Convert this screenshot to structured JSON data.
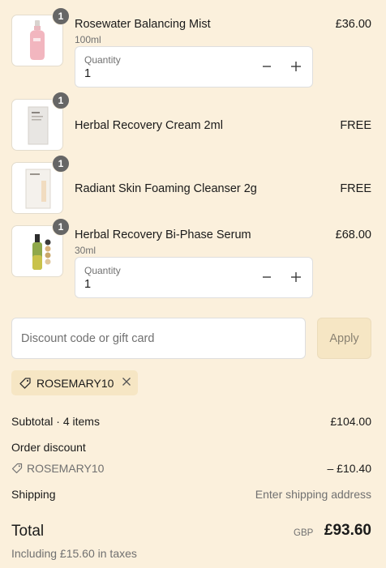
{
  "line_items": [
    {
      "name": "Rosewater Balancing Mist",
      "variant": "100ml",
      "price": "£36.00",
      "qty_badge": "1",
      "quantity_label": "Quantity",
      "quantity_value": "1",
      "image_icon": "pink-mist-bottle-icon"
    },
    {
      "name": "Herbal Recovery Cream 2ml",
      "price": "FREE",
      "qty_badge": "1",
      "image_icon": "cream-sachet-icon"
    },
    {
      "name": "Radiant Skin Foaming Cleanser 2g",
      "price": "FREE",
      "qty_badge": "1",
      "image_icon": "cleanser-sachet-icon"
    },
    {
      "name": "Herbal Recovery Bi-Phase Serum",
      "variant": "30ml",
      "price": "£68.00",
      "qty_badge": "1",
      "quantity_label": "Quantity",
      "quantity_value": "1",
      "image_icon": "serum-bottle-icon"
    }
  ],
  "discount": {
    "placeholder": "Discount code or gift card",
    "apply_label": "Apply",
    "applied_code": "ROSEMARY10"
  },
  "summary": {
    "subtotal_label": "Subtotal · 4 items",
    "subtotal_value": "£104.00",
    "order_discount_label": "Order discount",
    "discount_code": "ROSEMARY10",
    "discount_value": "– £10.40",
    "shipping_label": "Shipping",
    "shipping_value": "Enter shipping address",
    "total_label": "Total",
    "currency": "GBP",
    "total_value": "£93.60",
    "taxes_note": "Including £15.60 in taxes"
  },
  "colors": {
    "background": "#fbf0dc",
    "badge": "#666666",
    "chip": "#f6e6c4",
    "muted_text": "#707070"
  }
}
